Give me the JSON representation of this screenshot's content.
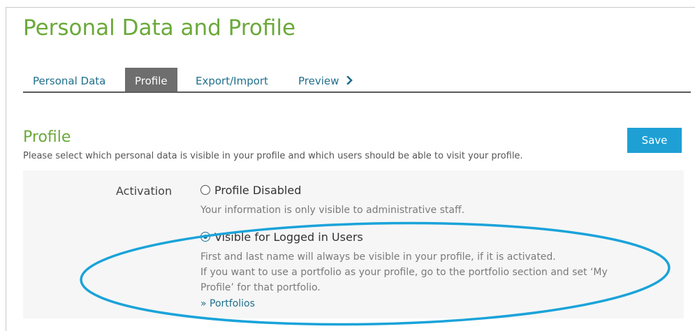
{
  "page": {
    "title": "Personal Data and Profile"
  },
  "tabs": [
    {
      "label": "Personal Data",
      "active": false
    },
    {
      "label": "Profile",
      "active": true
    },
    {
      "label": "Export/Import",
      "active": false
    },
    {
      "label": "Preview",
      "active": false,
      "icon": "chevron-right-icon"
    }
  ],
  "profile_section": {
    "title": "Profile",
    "description": "Please select which personal data is visible in your profile and which users should be able to visit your profile.",
    "save_label": "Save"
  },
  "activation": {
    "label": "Activation",
    "options": [
      {
        "label": "Profile Disabled",
        "selected": false,
        "hints": [
          "Your information is only visible to administrative staff."
        ]
      },
      {
        "label": "Visible for Logged in Users",
        "selected": true,
        "hints": [
          "First and last name will always be visible in your profile, if it is activated.",
          "If you want to use a portfolio as your profile, go to the portfolio section and set ‘My",
          "Profile’ for that portfolio."
        ]
      }
    ],
    "link_label": "» Portfolios"
  },
  "colors": {
    "title_green": "#6aa93a",
    "link_blue": "#1f6f8b",
    "save_button": "#1ea0d5",
    "tab_active_bg": "#6e6e6e",
    "highlight_ellipse": "#1aa3d9"
  }
}
